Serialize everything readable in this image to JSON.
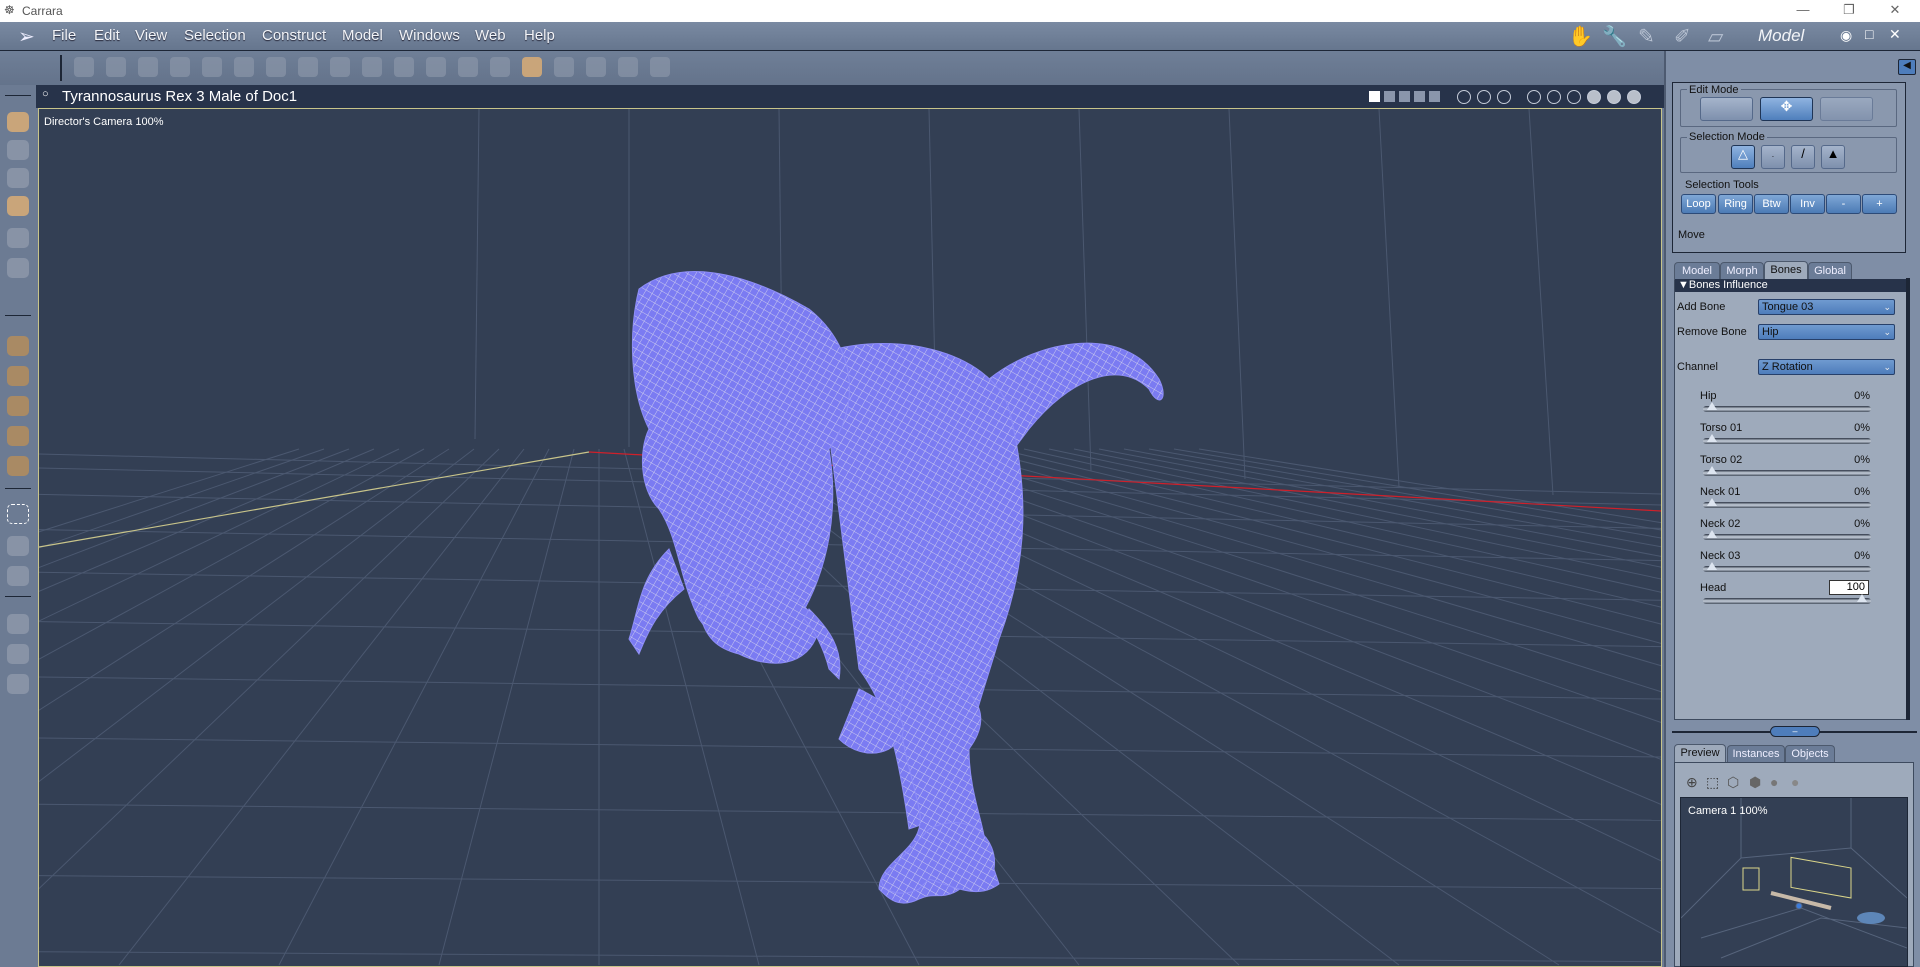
{
  "app": {
    "title": "Carrara",
    "room": "Model"
  },
  "menu": [
    "File",
    "Edit",
    "View",
    "Selection",
    "Construct",
    "Model",
    "Windows",
    "Web",
    "Help"
  ],
  "document": {
    "title": "Tyrannosaurus Rex 3 Male of Doc1",
    "camera_label": "Director's Camera 100%"
  },
  "colors": {
    "mesh": "#7b7bf2",
    "viewport_bg": "#333f54",
    "accent": "#4e7dbb",
    "x_axis": "#d0202a",
    "z_axis": "#c8c48a"
  },
  "panel": {
    "edit_mode_label": "Edit Mode",
    "selection_mode_label": "Selection Mode",
    "selection_tools_label": "Selection Tools",
    "selection_tools": [
      "Loop",
      "Ring",
      "Btw",
      "Inv",
      "-",
      "+"
    ],
    "move_label": "Move",
    "tabs": [
      "Model",
      "Morph",
      "Bones",
      "Global"
    ],
    "active_tab": "Bones",
    "section": "Bones Influence",
    "add_bone_label": "Add Bone",
    "add_bone_value": "Tongue 03",
    "remove_bone_label": "Remove Bone",
    "remove_bone_value": "Hip",
    "channel_label": "Channel",
    "channel_value": "Z Rotation",
    "bones": [
      {
        "name": "Hip",
        "value": "0%",
        "level": 0
      },
      {
        "name": "Torso 01",
        "value": "0%",
        "level": 0
      },
      {
        "name": "Torso 02",
        "value": "0%",
        "level": 0
      },
      {
        "name": "Neck 01",
        "value": "0%",
        "level": 0
      },
      {
        "name": "Neck 02",
        "value": "0%",
        "level": 0
      },
      {
        "name": "Neck 03",
        "value": "0%",
        "level": 0
      },
      {
        "name": "Head",
        "value": "100",
        "level": 100
      }
    ]
  },
  "preview": {
    "tabs": [
      "Preview",
      "Instances",
      "Objects"
    ],
    "active_tab": "Preview",
    "camera_label": "Camera 1 100%"
  }
}
